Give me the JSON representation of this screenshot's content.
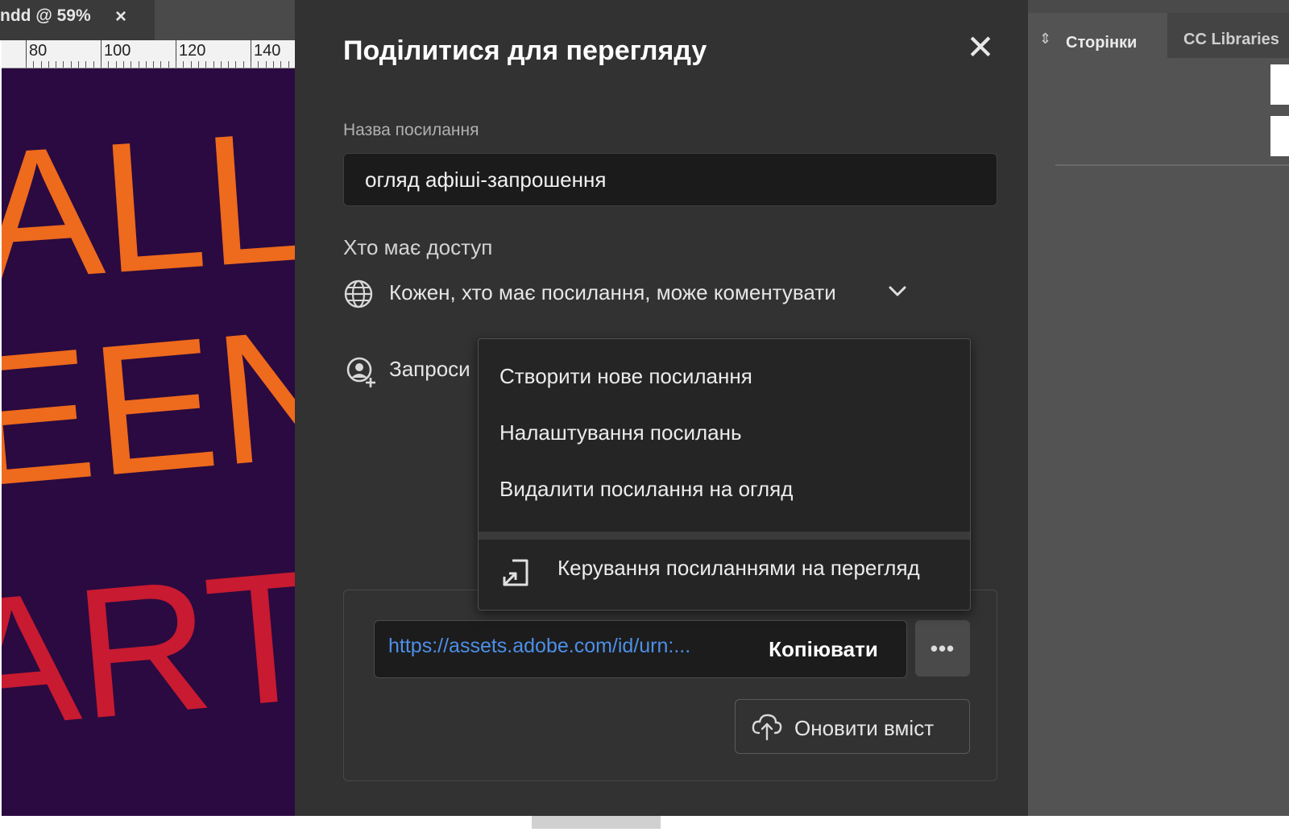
{
  "document": {
    "tab_title": "ndd @ 59%",
    "tab_close": "×",
    "ruler_labels": [
      "80",
      "100",
      "120",
      "140"
    ],
    "canvas_text": [
      "ALLO",
      "EEN",
      "ARTY"
    ],
    "colors": {
      "canvas_bg": "#2a0a40",
      "orange": "#ee6a1c",
      "red": "#c81a30"
    }
  },
  "panel": {
    "tabs": [
      {
        "label": "Сторінки",
        "icon": "pages-icon",
        "active": true
      },
      {
        "label": "CC Libraries",
        "active": false
      }
    ]
  },
  "dialog": {
    "title": "Поділитися для перегляду",
    "close_label": "✕",
    "link_name": {
      "label": "Назва посилання",
      "value": "огляд афіші-запрошення"
    },
    "access": {
      "label": "Хто має доступ",
      "value": "Кожен, хто має посилання, може коментувати",
      "icon": "globe-icon"
    },
    "invite": {
      "label": "Запроси",
      "icon": "add-person-icon"
    },
    "link": {
      "url": "https://assets.adobe.com/id/urn:...",
      "copy_label": "Копіювати",
      "more_label": "•••",
      "url_color": "#4d8fe8"
    },
    "update_button": {
      "label": "Оновити вміст",
      "icon": "cloud-upload-icon"
    },
    "menu": {
      "items": [
        "Створити нове посилання",
        "Налаштування посилань",
        "Видалити посилання на огляд"
      ],
      "manage_label": "Керування посиланнями на перегляд",
      "manage_icon": "open-external-icon"
    }
  }
}
